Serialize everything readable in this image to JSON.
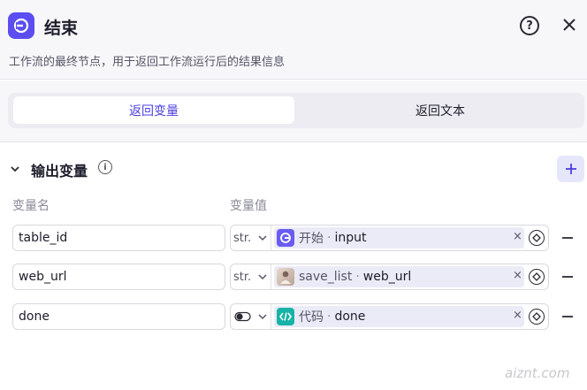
{
  "header": {
    "title": "结束",
    "description": "工作流的最终节点，用于返回工作流运行后的结果信息",
    "help_label": "?"
  },
  "tabs": [
    {
      "label": "返回变量",
      "active": true
    },
    {
      "label": "返回文本",
      "active": false
    }
  ],
  "output_section": {
    "title": "输出变量",
    "info_label": "i",
    "columns": {
      "name": "变量名",
      "value": "变量值"
    }
  },
  "rows": [
    {
      "name": "table_id",
      "type": "str.",
      "node": "开始",
      "separator": "·",
      "variable": "input",
      "clear": "×",
      "icon": "start-node-icon"
    },
    {
      "name": "web_url",
      "type": "str.",
      "node": "save_list",
      "separator": "·",
      "variable": "web_url",
      "clear": "×",
      "icon": "avatar-thumbnail"
    },
    {
      "name": "done",
      "type": "",
      "node": "代码",
      "separator": "·",
      "variable": "done",
      "clear": "×",
      "icon": "code-node-icon"
    }
  ],
  "watermark": "aiznt.com",
  "colors": {
    "accent": "#5b4df0",
    "start_icon": "#6a5cf2",
    "code_icon": "#17b3a6",
    "chip_bg": "#ebebf7"
  }
}
